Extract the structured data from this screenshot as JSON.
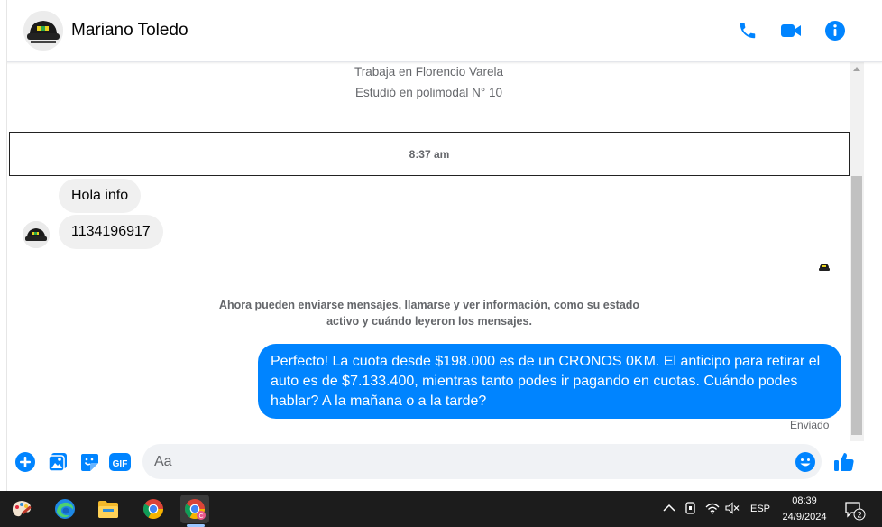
{
  "header": {
    "contact_name": "Mariano Toledo"
  },
  "profile_info": {
    "work": "Trabaja en Florencio Varela",
    "education": "Estudió en polimodal N° 10"
  },
  "messages": {
    "timestamp": "8:37 am",
    "incoming": [
      "Hola info",
      "1134196917"
    ],
    "system_note": "Ahora pueden enviarse mensajes, llamarse y ver información, como su estado activo y cuándo leyeron los mensajes.",
    "outgoing": "Perfecto! La cuota desde $198.000 es de un CRONOS 0KM. El anticipo para retirar el auto es de $7.133.400, mientras tanto podes ir pagando en cuotas. Cuándo podes hablar? A la mañana o a la tarde?",
    "status": "Enviado"
  },
  "composer": {
    "placeholder": "Aa",
    "gif_label": "GIF"
  },
  "taskbar": {
    "language": "ESP",
    "time": "08:39",
    "date": "24/9/2024",
    "notification_count": "2"
  },
  "colors": {
    "accent": "#0084ff",
    "incoming_bubble": "#f0f0f0",
    "taskbar": "#1c1c1c"
  },
  "icons": {
    "header": [
      "phone-icon",
      "video-camera-icon",
      "info-icon"
    ],
    "composer": [
      "plus-icon",
      "image-icon",
      "sticker-icon",
      "gif-icon",
      "emoji-icon",
      "thumbs-up-icon"
    ],
    "taskbar": [
      "paint-icon",
      "edge-icon",
      "file-explorer-icon",
      "chrome-icon",
      "chrome-profile-icon"
    ]
  }
}
